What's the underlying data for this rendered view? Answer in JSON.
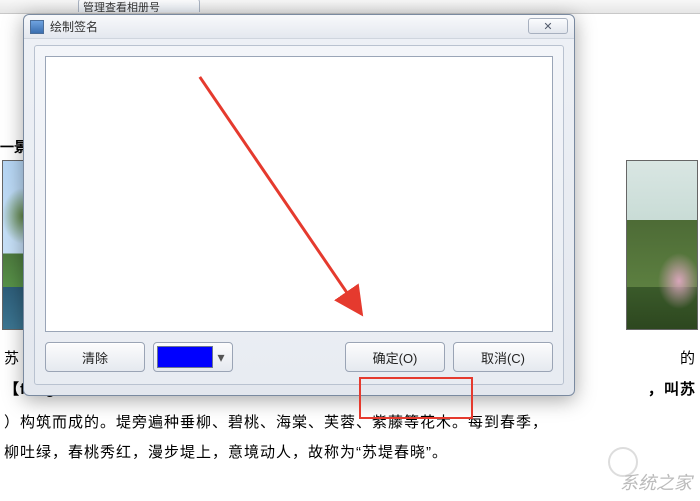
{
  "topbar": {
    "tab_label": "管理查看相册号"
  },
  "dialog": {
    "title": "绘制签名",
    "buttons": {
      "clear": "清除",
      "ok": "确定(O)",
      "cancel": "取消(C)"
    },
    "close_glyph": "✕",
    "color": "#0000FF",
    "dropdown_glyph": "▾"
  },
  "document": {
    "heading_partial": "一景",
    "line1_left": "苏",
    "line1_right": "的",
    "line2_left": "【fèng】",
    "line2_right": "，叫苏",
    "line3": "）构筑而成的。堤旁遍种垂柳、碧桃、海棠、芙蓉、紫藤等花木。每到春季，",
    "line4": "柳吐绿，春桃秀红，漫步堤上，意境动人，故称为“苏堤春晓”。",
    "line5": ""
  },
  "watermark": "系统之家"
}
